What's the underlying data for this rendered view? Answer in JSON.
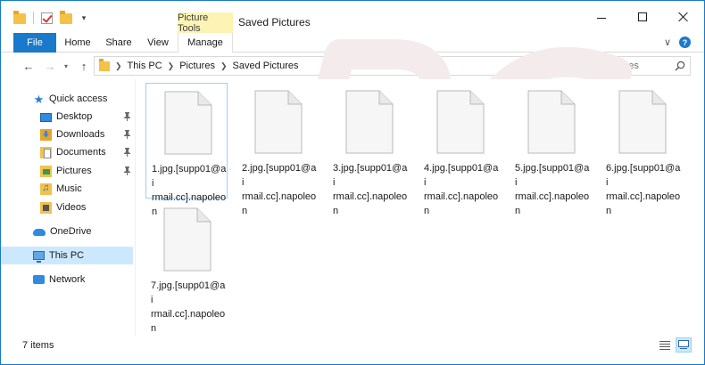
{
  "window": {
    "title": "Saved Pictures",
    "contextual_group": "Picture Tools"
  },
  "ribbon": {
    "tabs": [
      "File",
      "Home",
      "Share",
      "View",
      "Manage"
    ]
  },
  "address": {
    "crumbs": [
      "This PC",
      "Pictures",
      "Saved Pictures"
    ]
  },
  "search": {
    "placeholder": "Search Saved Pictures"
  },
  "sidebar": {
    "items": [
      {
        "label": "Quick access",
        "icon": "quick-access-star-icon",
        "pinned": false
      },
      {
        "label": "Desktop",
        "icon": "desktop-folder-icon",
        "pinned": true
      },
      {
        "label": "Downloads",
        "icon": "downloads-folder-icon",
        "pinned": true
      },
      {
        "label": "Documents",
        "icon": "documents-folder-icon",
        "pinned": true
      },
      {
        "label": "Pictures",
        "icon": "pictures-folder-icon",
        "pinned": true
      },
      {
        "label": "Music",
        "icon": "music-folder-icon",
        "pinned": false
      },
      {
        "label": "Videos",
        "icon": "videos-folder-icon",
        "pinned": false
      },
      {
        "label": "OneDrive",
        "icon": "onedrive-cloud-icon",
        "pinned": false
      },
      {
        "label": "This PC",
        "icon": "this-pc-icon",
        "pinned": false,
        "selected": true
      },
      {
        "label": "Network",
        "icon": "network-icon",
        "pinned": false
      }
    ]
  },
  "files": [
    {
      "name": "1.jpg.[supp01@airmail.cc].napoleon",
      "lines": [
        "1.jpg.[supp01@ai",
        "rmail.cc].napoleo",
        "n"
      ]
    },
    {
      "name": "2.jpg.[supp01@airmail.cc].napoleon",
      "lines": [
        "2.jpg.[supp01@ai",
        "rmail.cc].napoleo",
        "n"
      ]
    },
    {
      "name": "3.jpg.[supp01@airmail.cc].napoleon",
      "lines": [
        "3.jpg.[supp01@ai",
        "rmail.cc].napoleo",
        "n"
      ]
    },
    {
      "name": "4.jpg.[supp01@airmail.cc].napoleon",
      "lines": [
        "4.jpg.[supp01@ai",
        "rmail.cc].napoleo",
        "n"
      ]
    },
    {
      "name": "5.jpg.[supp01@airmail.cc].napoleon",
      "lines": [
        "5.jpg.[supp01@ai",
        "rmail.cc].napoleo",
        "n"
      ]
    },
    {
      "name": "6.jpg.[supp01@airmail.cc].napoleon",
      "lines": [
        "6.jpg.[supp01@ai",
        "rmail.cc].napoleo",
        "n"
      ]
    },
    {
      "name": "7.jpg.[supp01@airmail.cc].napoleon",
      "lines": [
        "7.jpg.[supp01@ai",
        "rmail.cc].napoleo",
        "n"
      ]
    }
  ],
  "status": {
    "item_count": "7 items"
  },
  "watermark": {
    "text": "pcrisk.com"
  },
  "colors": {
    "accent": "#1979ca",
    "contextual_tab": "#fcf3b4",
    "selection": "#cce8ff",
    "folder": "#f3c246"
  }
}
